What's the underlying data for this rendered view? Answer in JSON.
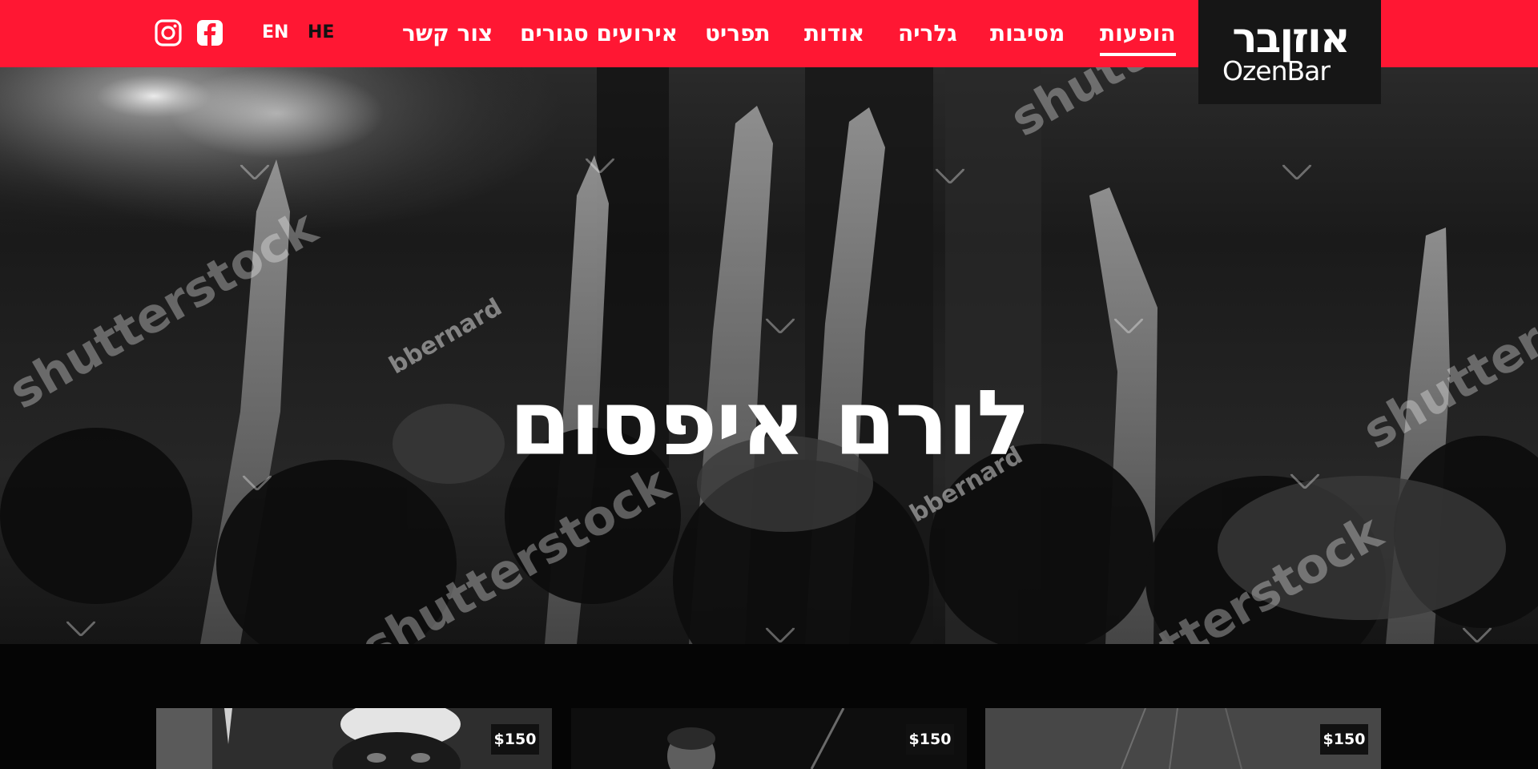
{
  "brand": {
    "logo_he": "אוזןבר",
    "logo_en": "OzenBar"
  },
  "nav": {
    "items": [
      {
        "label": "הופעות",
        "active": true
      },
      {
        "label": "מסיבות",
        "active": false
      },
      {
        "label": "גלריה",
        "active": false
      },
      {
        "label": "אודות",
        "active": false
      },
      {
        "label": "תפריט",
        "active": false
      },
      {
        "label": "אירועים סגורים",
        "active": false
      },
      {
        "label": "צור קשר",
        "active": false
      }
    ]
  },
  "language": {
    "en": "EN",
    "he": "HE",
    "selected": "HE"
  },
  "social": {
    "icons": [
      "instagram-icon",
      "facebook-icon"
    ]
  },
  "hero": {
    "title": "לורם איפסום",
    "watermark_brand": "shutterstock",
    "watermark_author": "bbernard"
  },
  "events": {
    "cards": [
      {
        "price": "$150"
      },
      {
        "price": "$150"
      },
      {
        "price": "$150"
      }
    ]
  },
  "colors": {
    "header_red": "#ff1733",
    "logo_bg": "#161616",
    "page_bg": "#000000"
  }
}
